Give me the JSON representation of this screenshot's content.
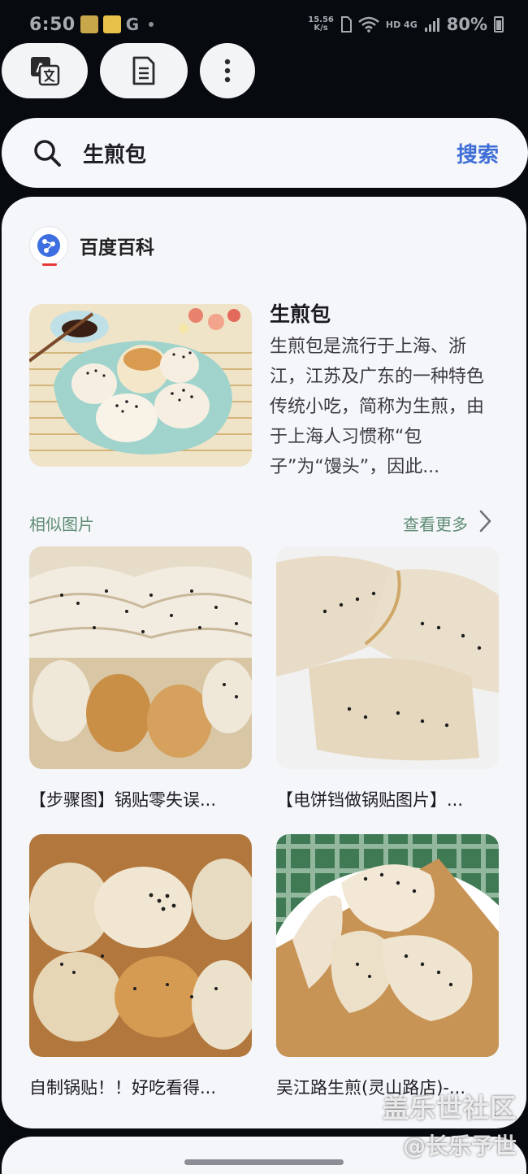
{
  "status_bar": {
    "time": "6:50",
    "notification_icons": [
      "gallery-notification-icon",
      "folder-notification-icon",
      "google-g-icon"
    ],
    "google_glyph": "G",
    "net_speed_value": "15.56",
    "net_speed_unit": "K/s",
    "network_label": "HD 4G",
    "battery": "80%"
  },
  "toolbar": {
    "translate_icon": "translate-icon",
    "document_icon": "document-icon",
    "more_icon": "more-vertical-icon"
  },
  "search": {
    "query": "生煎包",
    "button_label": "搜索"
  },
  "result": {
    "source_name": "百度百科",
    "title": "生煎包",
    "description": "生煎包是流行于上海、浙江，江苏及广东的一种特色传统小吃，简称为生煎，由于上海人习惯称“包子”为“馒头”，因此..."
  },
  "similar_images": {
    "label": "相似图片",
    "more_label": "查看更多",
    "items": [
      {
        "caption": "【步骤图】锅贴零失误..."
      },
      {
        "caption": "【电饼铛做锅贴图片】..."
      },
      {
        "caption": "自制锅贴！！好吃看得..."
      },
      {
        "caption": "吴江路生煎(灵山路店)-..."
      }
    ]
  },
  "watermark": {
    "line1": "盖乐世社区",
    "line2": "@长乐予世"
  },
  "colors": {
    "background": "#070b10",
    "card": "#f5f6fa",
    "accent_blue": "#3f6fd6",
    "accent_green": "#5f8c74"
  }
}
